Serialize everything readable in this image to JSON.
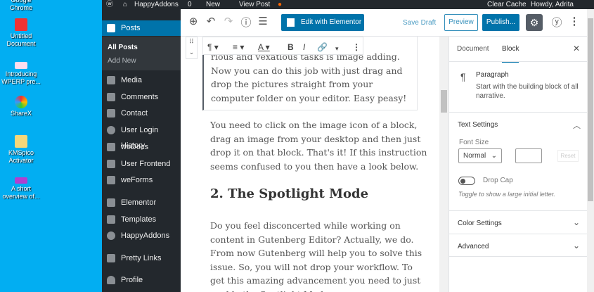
{
  "desktop": [
    {
      "label": "Google Chrome"
    },
    {
      "label": "Untitled Document"
    },
    {
      "label": "Introducing WPERP pre..."
    },
    {
      "label": "ShareX"
    },
    {
      "label": "KMSpico Activator"
    },
    {
      "label": "A short overview of..."
    }
  ],
  "adminbar": {
    "site": "HappyAddons",
    "comments": "0",
    "new": "New",
    "view": "View Post",
    "clear_cache": "Clear Cache",
    "howdy": "Howdy, Adrita"
  },
  "sidebar": {
    "items": [
      {
        "label": "Posts"
      },
      {
        "label": "Media"
      },
      {
        "label": "Comments"
      },
      {
        "label": "Contact"
      },
      {
        "label": "User Login History"
      },
      {
        "label": "weDocs"
      },
      {
        "label": "User Frontend"
      },
      {
        "label": "weForms"
      },
      {
        "label": "Elementor"
      },
      {
        "label": "Templates"
      },
      {
        "label": "HappyAddons"
      },
      {
        "label": "Pretty Links"
      },
      {
        "label": "Profile"
      }
    ],
    "submenu": [
      "All Posts",
      "Add New"
    ]
  },
  "header": {
    "elementor": "Edit with Elementor",
    "save_draft": "Save Draft",
    "preview": "Preview",
    "publish": "Publish..."
  },
  "content": {
    "block_text": "rious and vexatious tasks is image adding. Now you can do this job with just drag and drop the pictures straight from your computer folder on your editor. Easy peasy!",
    "para2": "You need to click on the image icon of a block, drag an image from your desktop and then just drop it on that block. That's it! If this instruction seems confused to you then have a look below.",
    "heading": "2. The Spotlight Mode",
    "para3": "Do you feel disconcerted while working on content in Gutenberg Editor? Actually, we do. From now Gutenberg will help you to solve this issue. So, you will not drop your workflow. To get this amazing advancement you need to just enable the Spotlight Mode."
  },
  "panel": {
    "tab_document": "Document",
    "tab_block": "Block",
    "block_name": "Paragraph",
    "block_desc": "Start with the building block of all narrative.",
    "text_settings": "Text Settings",
    "font_size_label": "Font Size",
    "font_size_value": "Normal",
    "reset": "Reset",
    "drop_cap": "Drop Cap",
    "drop_cap_help": "Toggle to show a large initial letter.",
    "color_settings": "Color Settings",
    "advanced": "Advanced"
  }
}
